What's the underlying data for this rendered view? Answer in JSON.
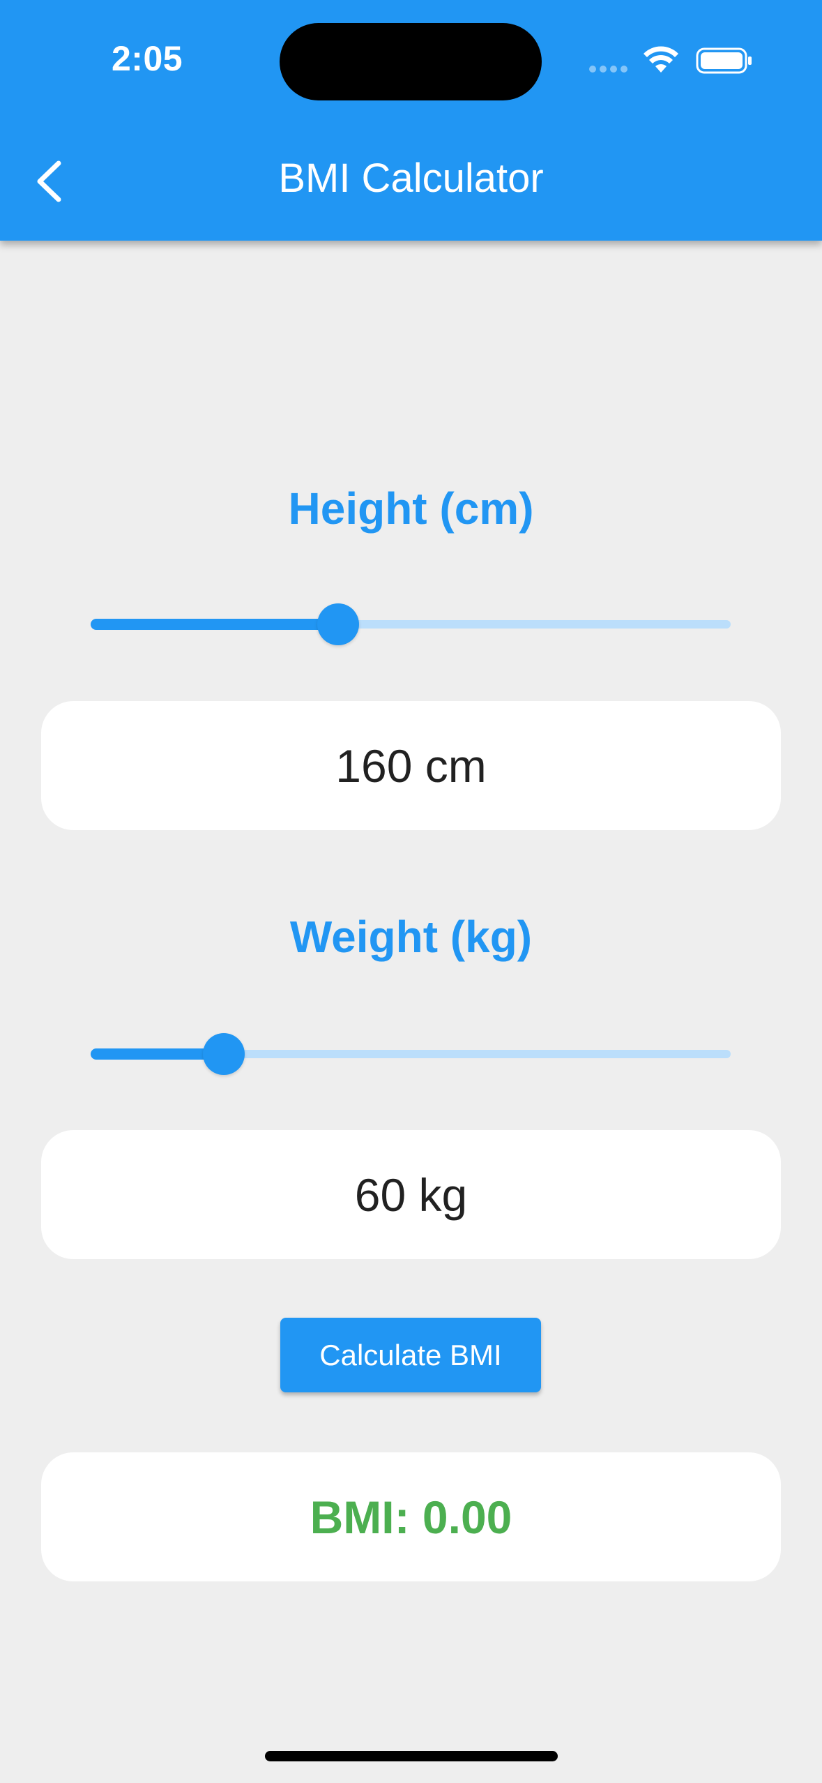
{
  "status_bar": {
    "time": "2:05"
  },
  "app_bar": {
    "title": "BMI Calculator",
    "back_icon": "chevron-left-icon",
    "color": "#2196F3"
  },
  "height": {
    "label": "Height (cm)",
    "value_text": "160 cm",
    "slider_fraction": 0.387
  },
  "weight": {
    "label": "Weight (kg)",
    "value_text": "60 kg",
    "slider_fraction": 0.208
  },
  "calculate_button": {
    "label": "Calculate BMI"
  },
  "result": {
    "text": "BMI: 0.00",
    "color": "#4CAF50"
  },
  "colors": {
    "accent": "#2196F3",
    "track_inactive": "#BBDEFB",
    "background": "#EEEEEE"
  }
}
